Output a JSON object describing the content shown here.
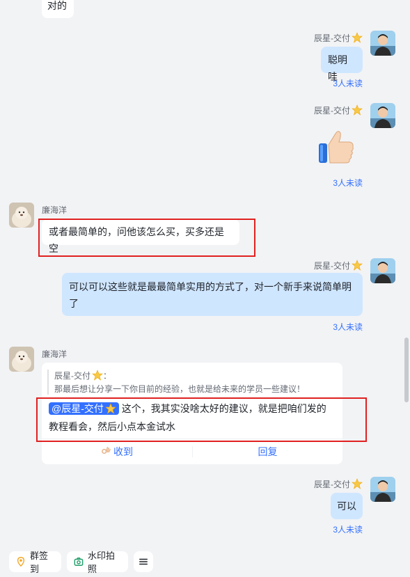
{
  "messages": [
    {
      "text": "对的"
    },
    {
      "sender": "辰星-交付",
      "text": "聪明哇",
      "unread": "3人未读"
    },
    {
      "sender": "辰星-交付",
      "sticker": "thumbs-up",
      "unread": "3人未读"
    },
    {
      "sender": "廉海洋",
      "text": "或者最简单的，问他该怎么买，买多还是空"
    },
    {
      "sender": "辰星-交付",
      "text_line1": "可以可以这些就是最最简单实用的方式了，对一个新手来说简单明",
      "text_line2": "了",
      "unread": "3人未读"
    },
    {
      "sender": "廉海洋",
      "quote_sender": "辰星-交付",
      "quote_colon": "：",
      "quote_text": "那最后想让分享一下你目前的经验，也就是给未来的学员一些建议！",
      "mention": "@辰星-交付",
      "text_line1": "这个，我其实没啥太好的建议，就是把咱们发的",
      "text_line2": "教程看会，然后小点本金试水",
      "received_label": "收到",
      "reply_label": "回复"
    },
    {
      "sender": "辰星-交付",
      "text": "可以",
      "unread": "3人未读"
    }
  ],
  "bottom_bar": {
    "checkin_label": "群签到",
    "watermark_label": "水印拍照"
  },
  "colors": {
    "background": "#f2f3f5",
    "self_bubble": "#cfe6ff",
    "unread_text": "#3370ff",
    "highlight_box": "#e02020"
  }
}
